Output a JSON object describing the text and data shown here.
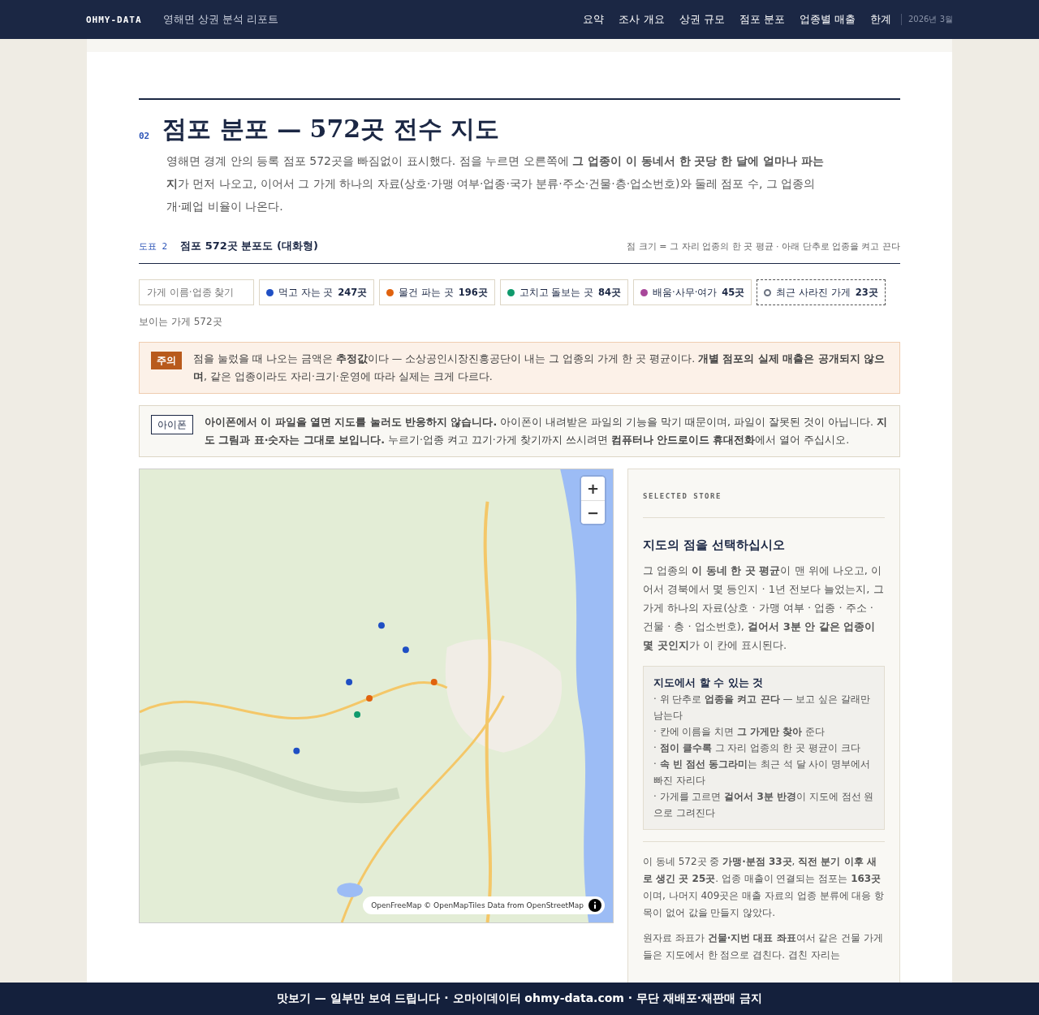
{
  "nav": {
    "brand": "OHMY-DATA",
    "subtitle": "영해면 상권 분석 리포트",
    "links": [
      {
        "label": "요약"
      },
      {
        "label": "조사 개요"
      },
      {
        "label": "상권 규모"
      },
      {
        "label": "점포 분포"
      },
      {
        "label": "업종별 매출"
      },
      {
        "label": "한계"
      }
    ],
    "date": "2026년 3월"
  },
  "section": {
    "number": "02",
    "title": "점포 분포 — 572곳 전수 지도",
    "intro": "영해면 경계 안의 등록 점포 572곳을 빠짐없이 표시했다. 점을 누르면 오른쪽에 **그 업종이 이 동네서 한 곳당 한 달에 얼마나 파는지**가 먼저 나오고, 이어서 그 가게 하나의 자료(상호·가맹 여부·업종·국가 분류·주소·건물·층·업소번호)와 둘레 점포 수, 그 업종의 개·폐업 비율이 나온다."
  },
  "figure": {
    "label": "도표 2",
    "title": "점포 572곳 분포도 (대화형)",
    "note": "점 크기 = 그 자리 업종의 한 곳 평균 · 아래 단추로 업종을 켜고 끈다"
  },
  "search": {
    "placeholder": "가게 이름·업종 찾기"
  },
  "filters": [
    {
      "kind": "category",
      "label": "먹고 자는 곳",
      "count": "247곳",
      "color": "#1f4fc4"
    },
    {
      "kind": "category",
      "label": "물건 파는 곳",
      "count": "196곳",
      "color": "#e0620e"
    },
    {
      "kind": "category",
      "label": "고치고 돌보는 곳",
      "count": "84곳",
      "color": "#0f9a6c"
    },
    {
      "kind": "category",
      "label": "배움·사무·여가",
      "count": "45곳",
      "color": "#a8479a"
    },
    {
      "kind": "closed",
      "label": "최근 사라진 가게",
      "count": "23곳",
      "color": "#6b7280"
    }
  ],
  "visible_count": "보이는 가게 572곳",
  "notices": [
    {
      "kind": "caution",
      "badge": "주의",
      "text": "점을 눌렀을 때 나오는 금액은 **추정값**이다 — 소상공인시장진흥공단이 내는 그 업종의 가게 한 곳 평균이다. **개별 점포의 실제 매출은 공개되지 않으며**, 같은 업종이라도 자리·크기·운영에 따라 실제는 크게 다르다."
    },
    {
      "kind": "info",
      "badge": "아이폰",
      "text": "**아이폰에서 이 파일을 열면 지도를 눌러도 반응하지 않습니다.** 아이폰이 내려받은 파일의 기능을 막기 때문이며, 파일이 잘못된 것이 아닙니다. **지도 그림과 표·숫자는 그대로 보입니다.** 누르기·업종 켜고 끄기·가게 찾기까지 쓰시려면 **컴퓨터나 안드로이드 휴대전화**에서 열어 주십시오."
    }
  ],
  "map": {
    "kind": "picture",
    "zoom_in": "+",
    "zoom_out": "−",
    "attribution": "OpenFreeMap © OpenMapTiles Data from OpenStreetMap"
  },
  "panel": {
    "eyebrow": "SELECTED STORE",
    "heading": "지도의 점을 선택하십시오",
    "body": "그 업종의 **이 동네 한 곳 평균**이 맨 위에 나오고, 이어서 경북에서 몇 등인지 · 1년 전보다 늘었는지, 그 가게 하나의 자료(상호 · 가맹 여부 · 업종 · 주소 · 건물 · 층 · 업소번호), **걸어서 3분 안 같은 업종이 몇 곳인지**가 이 칸에 표시된다.",
    "tips": {
      "title": "지도에서 할 수 있는 것",
      "items": [
        "· 위 단추로 **업종을 켜고 끈다** — 보고 싶은 갈래만 남는다",
        "· 칸에 이름을 치면 **그 가게만 찾아** 준다",
        "· **점이 클수록** 그 자리 업종의 한 곳 평균이 크다",
        "· **속 빈 점선 동그라미**는 최근 석 달 사이 명부에서 빠진 자리다",
        "· 가게를 고르면 **걸어서 3분 반경**이 지도에 점선 원으로 그려진다"
      ]
    },
    "stats": "이 동네 572곳 중 **가맹·분점 33곳**, **직전 분기 이후 새로 생긴 곳 25곳**. 업종 매출이 연결되는 점포는 **163곳**이며, 나머지 409곳은 매출 자료의 업종 분류에 대응 항목이 없어 값을 만들지 않았다.",
    "note": "원자료 좌표가 **건물·지번 대표 좌표**여서 같은 건물 가게들은 지도에서 한 점으로 겹친다. 겹친 자리는"
  },
  "banner": "맛보기 — 일부만 보여 드립니다 · 오마이데이터 ohmy-data.com · 무단 재배포·재판매 금지"
}
